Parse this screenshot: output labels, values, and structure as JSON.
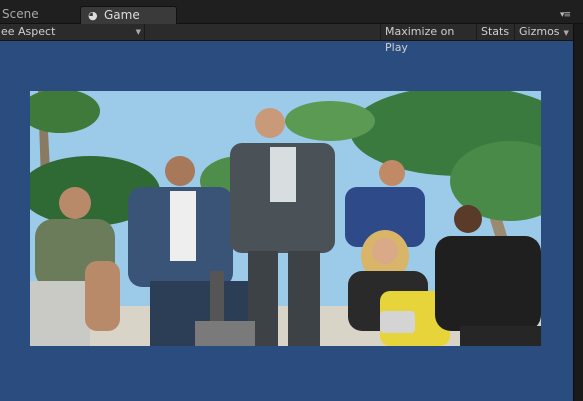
{
  "tabs": {
    "scene": "Scene",
    "game": "Game",
    "menu": "▾≡"
  },
  "toolbar": {
    "aspect": "ee Aspect",
    "maximize_on_play": "Maximize on Play",
    "stats": "Stats",
    "gizmos": "Gizmos"
  },
  "colors": {
    "background": "#2b4c7e",
    "tabbar": "#1f1f1f",
    "toolbar": "#2b2b2b",
    "sky": "#8ec3e6"
  }
}
